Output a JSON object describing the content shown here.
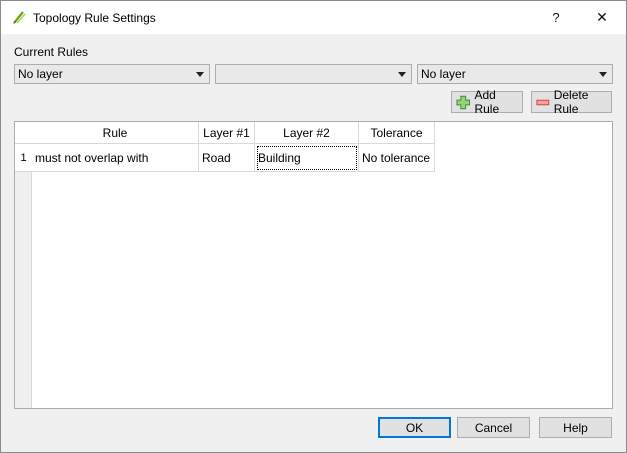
{
  "window": {
    "title": "Topology Rule Settings",
    "help_glyph": "?",
    "close_glyph": "✕",
    "app_icon": "qgis-topology-checker-icon"
  },
  "current_rules_label": "Current Rules",
  "combos": [
    {
      "value": ""
    },
    {
      "value": ""
    },
    {
      "value": "No layer"
    }
  ],
  "combo_first_value": "No layer",
  "toolbar": {
    "add_rule_label": "Add Rule",
    "delete_rule_label": "Delete Rule"
  },
  "table": {
    "headers": [
      "Rule",
      "Layer #1",
      "Layer #2",
      "Tolerance"
    ],
    "rows": [
      {
        "num": "1",
        "rule": "must not overlap with",
        "layer1": "Road",
        "layer2": "Building",
        "tolerance": "No tolerance"
      }
    ]
  },
  "footer": {
    "ok_label": "OK",
    "cancel_label": "Cancel",
    "help_label": "Help"
  },
  "colors": {
    "ok_border": "#0078d7",
    "add_icon_green": "#3a8d2e",
    "delete_icon_red": "#d23a3a"
  }
}
